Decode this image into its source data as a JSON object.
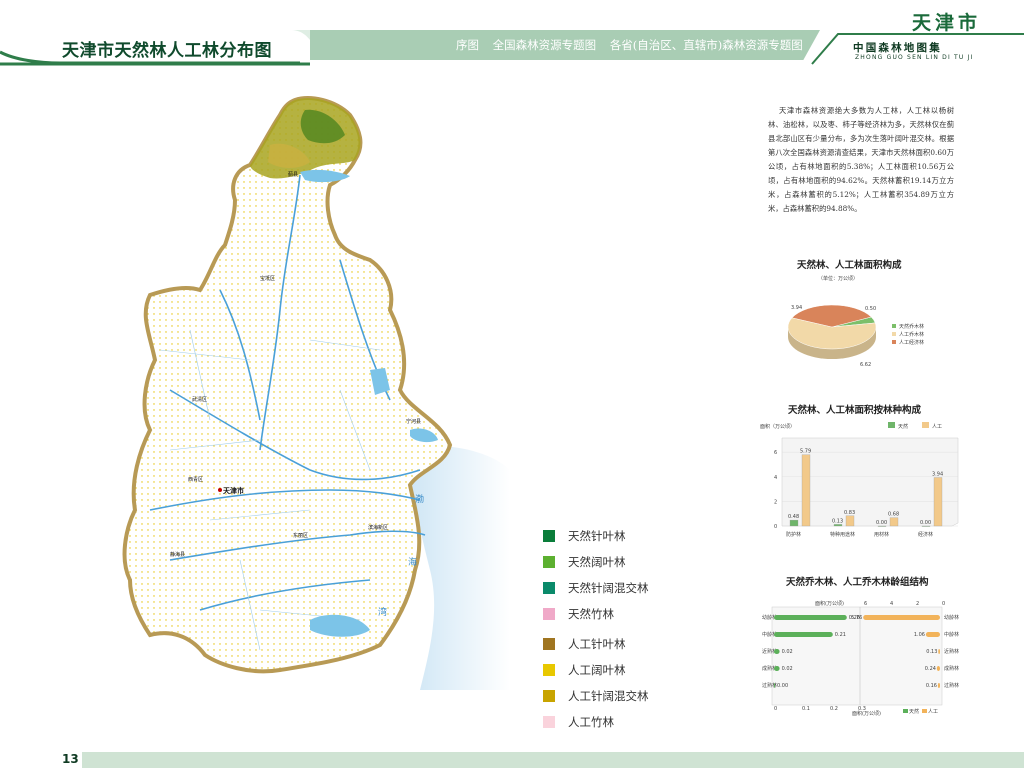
{
  "header": {
    "title": "天津市天然林人工林分布图",
    "nav": [
      "序图",
      "全国森林资源专题图",
      "各省(自治区、直辖市)森林资源专题图"
    ],
    "city": "天津市",
    "atlas_cn": "中国森林地图集",
    "atlas_en": "ZHONG GUO SEN LIN DI TU JI"
  },
  "map": {
    "labels": {
      "sea1": "渤",
      "sea2": "海",
      "sea3": "湾",
      "capital": "天津市",
      "jixian": "蓟县",
      "baodi": "宝坻区",
      "wuqing": "武清区",
      "ninghe": "宁河县",
      "xiqing": "西青区",
      "jinghai": "静海县",
      "dongli": "东丽区",
      "binhai": "滨海新区"
    }
  },
  "legend": [
    {
      "label": "天然针叶林",
      "color": "#0a7d3a"
    },
    {
      "label": "天然阔叶林",
      "color": "#5cb030"
    },
    {
      "label": "天然针阔混交林",
      "color": "#0a8a6a"
    },
    {
      "label": "天然竹林",
      "color": "#f0a9c8"
    },
    {
      "label": "人工针叶林",
      "color": "#a07520"
    },
    {
      "label": "人工阔叶林",
      "color": "#e8c800"
    },
    {
      "label": "人工针阔混交林",
      "color": "#c8a400"
    },
    {
      "label": "人工竹林",
      "color": "#fad3dc"
    }
  ],
  "description": "天津市森林资源绝大多数为人工林，人工林以杨树林、油松林，以及枣、柿子等经济林为多，天然林仅在蓟县北部山区有少量分布，多为次生落叶阔叶混交林。根据第八次全国森林资源清查结果，天津市天然林面积0.60万公顷，占有林地面积的5.38%；人工林面积10.56万公顷，占有林地面积的94.62%。天然林蓄积19.14万立方米，占森林蓄积的5.12%；人工林蓄积354.89万立方米，占森林蓄积的94.88%。",
  "chart_data": [
    {
      "type": "pie",
      "title": "天然林、人工林面积构成",
      "unit": "（单位：万公顷）",
      "slices": [
        {
          "name": "天然乔木林",
          "value": 0.5,
          "color": "#7cbf6a"
        },
        {
          "name": "人工乔木林",
          "value": 6.62,
          "color": "#f2d9a8"
        },
        {
          "name": "人工经济林",
          "value": 3.94,
          "color": "#d9845a"
        }
      ],
      "value_labels": [
        "3.94",
        "0.50",
        "6.62"
      ]
    },
    {
      "type": "bar",
      "title": "天然林、人工林面积按林种构成",
      "ylabel": "面积（万公顷）",
      "categories": [
        "防护林",
        "特种用途林",
        "用材林",
        "经济林"
      ],
      "series": [
        {
          "name": "天然",
          "values": [
            0.48,
            0.13,
            0,
            0
          ],
          "color": "#6fb56a"
        },
        {
          "name": "人工",
          "values": [
            5.79,
            0.83,
            0.68,
            3.94
          ],
          "color": "#f2c98a"
        }
      ],
      "value_labels": {
        "天然": [
          "0.48",
          "0.13",
          "0.00",
          "0.00"
        ],
        "人工": [
          "5.79",
          "0.83",
          "0.68",
          "3.94"
        ]
      },
      "yticks": [
        "0",
        "2",
        "4",
        "6"
      ],
      "ylim": [
        0,
        6.5
      ]
    },
    {
      "type": "bar",
      "orientation": "horizontal-butterfly",
      "title": "天然乔木林、人工乔木林龄组结构",
      "categories": [
        "幼龄林",
        "中龄林",
        "近熟林",
        "成熟林",
        "过熟林"
      ],
      "categories_right": [
        "幼龄林",
        "中龄林",
        "近熟林",
        "成熟林",
        "过熟林"
      ],
      "series": [
        {
          "name": "天然",
          "values": [
            0.26,
            0.21,
            0.02,
            0.02,
            0
          ],
          "color": "#5cb05a"
        },
        {
          "name": "人工",
          "values": [
            5.76,
            1.06,
            0.13,
            0.24,
            0.16
          ],
          "color": "#f2b35a"
        }
      ],
      "value_labels": {
        "天然": [
          "0.26",
          "0.21",
          "0.02",
          "0.02",
          "0.00"
        ],
        "人工": [
          "5.76",
          "1.06",
          "0.13",
          "0.24",
          "0.16"
        ]
      },
      "axis_label": "面积(万公顷)",
      "top_ticks": [
        "6",
        "4",
        "2",
        "0"
      ],
      "bottom_ticks": [
        "0",
        "0.1",
        "0.2",
        "0.3"
      ],
      "legend": [
        "天然",
        "人工"
      ]
    }
  ],
  "page": {
    "number": "13"
  }
}
